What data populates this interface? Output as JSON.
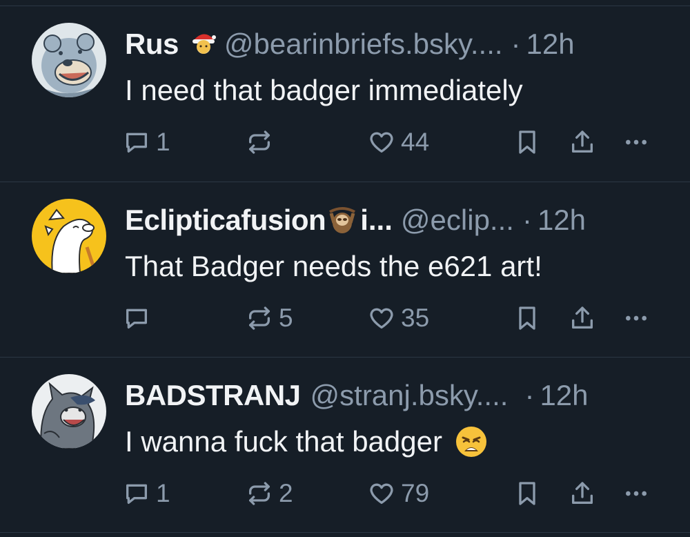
{
  "posts": [
    {
      "name": "Rus",
      "name_emoji": "santa-emoji",
      "name_suffix": "",
      "handle": "@bearinbriefs.bsky....",
      "separator": "·",
      "time": "12h",
      "text": "I need that badger immediately",
      "text_emoji": "",
      "replies": "1",
      "reposts": "",
      "likes": "44",
      "avatar": "bear-avatar"
    },
    {
      "name": "Eclipticafusion",
      "name_emoji": "sloth-emoji",
      "name_suffix": "i...",
      "handle": "@eclip...",
      "separator": "·",
      "time": "12h",
      "text": "That Badger needs the e621 art!",
      "text_emoji": "",
      "replies": "",
      "reposts": "5",
      "likes": "35",
      "avatar": "white-creature-avatar"
    },
    {
      "name": "BADSTRANJ",
      "name_emoji": "",
      "name_suffix": "",
      "handle": "@stranj.bsky....",
      "separator": "·",
      "time": "12h",
      "text": "I wanna fuck that badger",
      "text_emoji": "weary-face-emoji",
      "replies": "1",
      "reposts": "2",
      "likes": "79",
      "avatar": "wolf-avatar"
    }
  ],
  "colors": {
    "background": "#161e27",
    "divider": "#2b3744",
    "primary_text": "#f1f3f5",
    "secondary_text": "#8c9bac"
  }
}
